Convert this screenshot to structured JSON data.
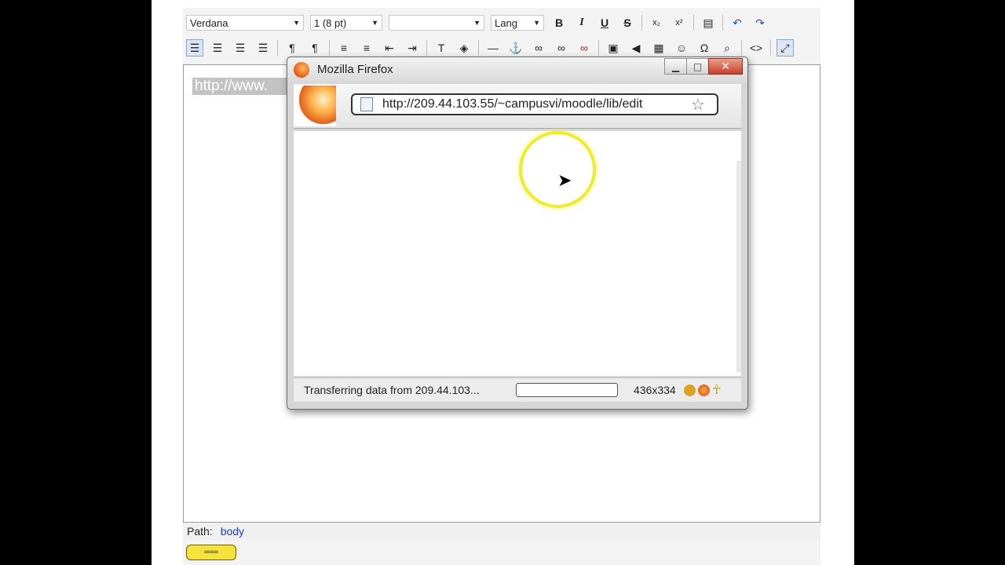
{
  "toolbar": {
    "font_family": "Verdana",
    "font_size": "1 (8 pt)",
    "style": "",
    "lang": "Lang",
    "bold": "B",
    "italic": "I",
    "underline": "U",
    "strike": "S"
  },
  "editor": {
    "content_text": "http://www.",
    "path_label": "Path:",
    "path_value": "body"
  },
  "popup": {
    "title": "Mozilla Firefox",
    "url": "http://209.44.103.55/~campusvi/moodle/lib/edit",
    "status_text": "Transferring data from 209.44.103...",
    "dimensions": "436x334",
    "progress": 0
  }
}
